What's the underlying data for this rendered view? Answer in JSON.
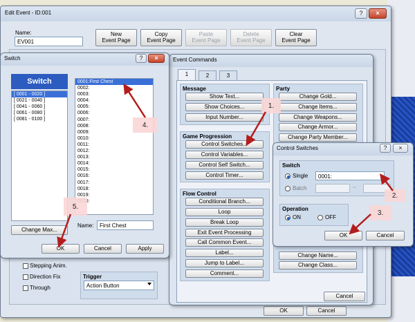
{
  "edit_event": {
    "title": "Edit Event - ID:001",
    "name_label": "Name:",
    "name_value": "EV001",
    "buttons": [
      "New\nEvent Page",
      "Copy\nEvent Page",
      "Paste\nEvent Page",
      "Delete\nEvent Page",
      "Clear\nEvent Page"
    ],
    "title_help": "?",
    "title_close": "×",
    "stepping_label": "Stepping Anim.",
    "direction_fix_label": "Direction Fix",
    "through_label": "Through",
    "trigger_label": "Trigger",
    "trigger_value": "Action Button",
    "ok": "OK",
    "cancel": "Cancel"
  },
  "switch_dialog": {
    "title": "Switch",
    "help": "?",
    "close": "×",
    "header": "Switch",
    "groups": [
      "[ 0001 - 0020 ]",
      "[ 0021 - 0040 ]",
      "[ 0041 - 0060 ]",
      "[ 0061 - 0080 ]",
      "[ 0081 - 0100 ]"
    ],
    "items": [
      "0001:First Chest",
      "0002:",
      "0003:",
      "0004:",
      "0005:",
      "0006:",
      "0007:",
      "0008:",
      "0009:",
      "0010:",
      "0011:",
      "0012:",
      "0013:",
      "0014:",
      "0015:",
      "0016:",
      "0017:",
      "0018:",
      "0019:",
      "0020:"
    ],
    "change_max": "Change Max...",
    "name_label": "Name:",
    "name_value": "First Chest",
    "ok": "OK",
    "cancel": "Cancel",
    "apply": "Apply"
  },
  "event_commands": {
    "title": "Event Commands",
    "tabs": [
      "1",
      "2",
      "3"
    ],
    "message": {
      "title": "Message",
      "items": [
        "Show Text...",
        "Show Choices...",
        "Input Number..."
      ]
    },
    "progression": {
      "title": "Game Progression",
      "items": [
        "Control Switches...",
        "Control Variables...",
        "Control Self Switch...",
        "Control Timer..."
      ]
    },
    "flow": {
      "title": "Flow Control",
      "items": [
        "Conditional Branch...",
        "Loop",
        "Break Loop",
        "Exit Event Processing",
        "Call Common Event...",
        "Label...",
        "Jump to Label...",
        "Comment..."
      ]
    },
    "party": {
      "title": "Party",
      "items": [
        "Change Gold...",
        "Change Items...",
        "Change Weapons...",
        "Change Armor...",
        "Change Party Member..."
      ]
    },
    "actor": {
      "items": [
        "Change Name...",
        "Change Class..."
      ]
    },
    "cancel": "Cancel"
  },
  "control_switches": {
    "title": "Control Switches",
    "help": "?",
    "close": "×",
    "switch_label": "Switch",
    "single_label": "Single",
    "single_value": "0001:",
    "batch_label": "Batch",
    "batch_tilde": "~",
    "operation_label": "Operation",
    "on_label": "ON",
    "off_label": "OFF",
    "ok": "OK",
    "cancel": "Cancel"
  },
  "background": {
    "ok": "OK",
    "cancel": "Cancel"
  },
  "callouts": [
    "1.",
    "2.",
    "3.",
    "4.",
    "5."
  ]
}
